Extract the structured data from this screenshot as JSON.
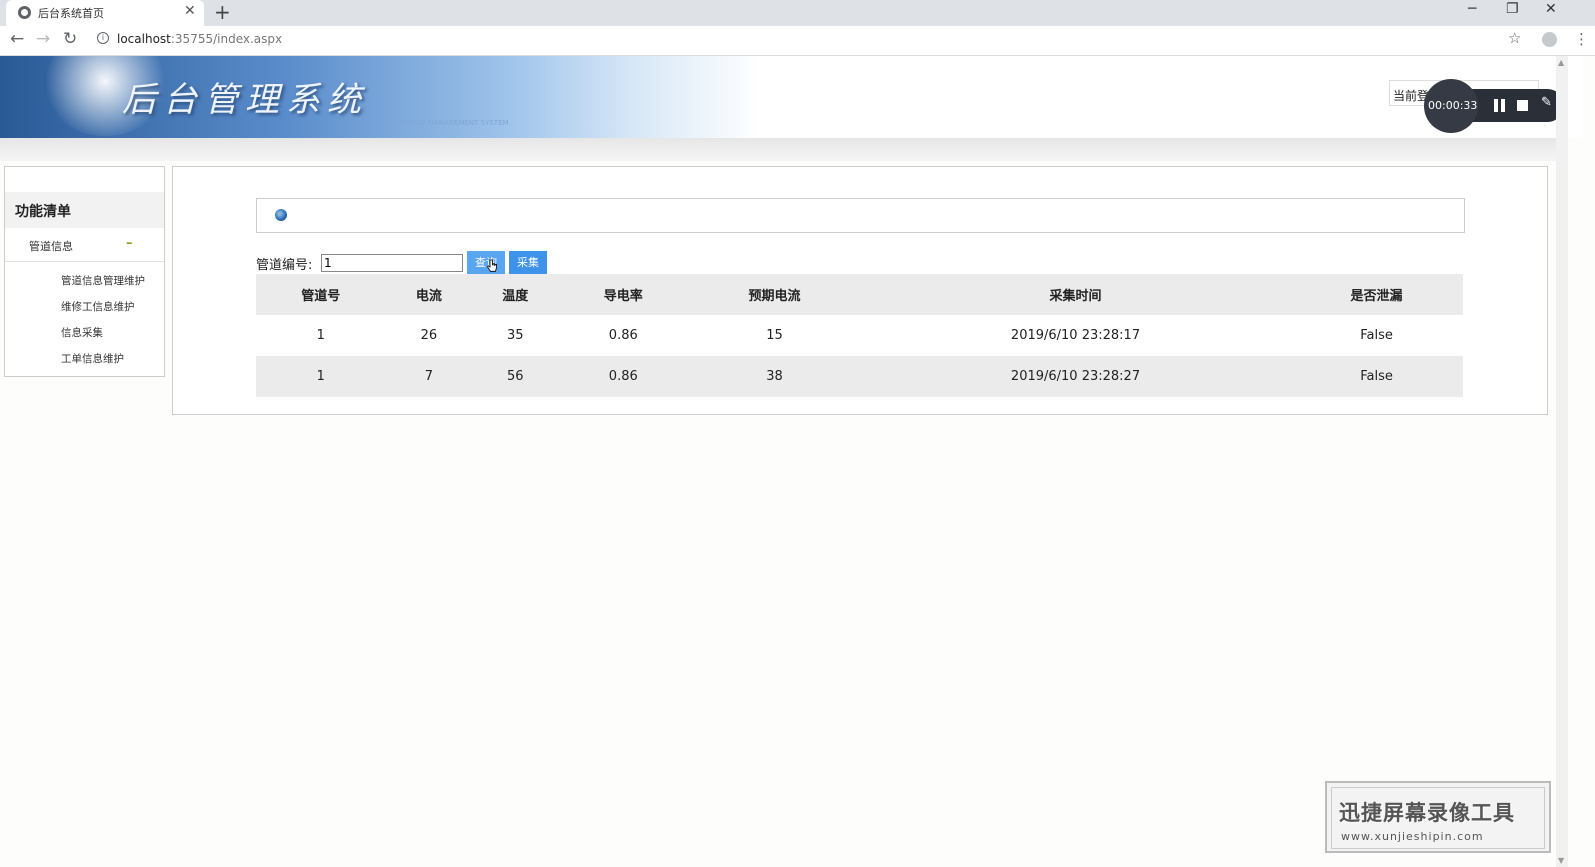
{
  "browser": {
    "tab_title": "后台系统首页",
    "tab_close": "✕",
    "new_tab": "+",
    "url_host": "localhost",
    "url_rest": ":35755/index.aspx",
    "controls": {
      "minimize": "─",
      "restore": "❐",
      "close": "✕"
    },
    "nav": {
      "back": "←",
      "forward": "→",
      "reload": "↻"
    },
    "star": "☆",
    "menu": "⋮"
  },
  "header": {
    "title": "后台管理系统",
    "subtitle": "BACKSTAGE MANAGEMENT SYSTEM",
    "login_label": "当前登"
  },
  "recorder": {
    "time": "00:00:33"
  },
  "sidebar": {
    "title": "功能清单",
    "group": {
      "label": "管道信息",
      "toggle": "–"
    },
    "items": [
      {
        "label": "管道信息管理维护"
      },
      {
        "label": "维修工信息维护"
      },
      {
        "label": "信息采集"
      },
      {
        "label": "工单信息维护"
      }
    ]
  },
  "query": {
    "label": "管道编号:",
    "value": "1",
    "query_button": "查询",
    "collect_button": "采集"
  },
  "table": {
    "headers": [
      "管道号",
      "电流",
      "温度",
      "导电率",
      "预期电流",
      "采集时间",
      "是否泄漏"
    ],
    "rows": [
      [
        "1",
        "26",
        "35",
        "0.86",
        "15",
        "2019/6/10 23:28:17",
        "False"
      ],
      [
        "1",
        "7",
        "56",
        "0.86",
        "38",
        "2019/6/10 23:28:27",
        "False"
      ]
    ]
  },
  "watermark": {
    "title": "迅捷屏幕录像工具",
    "url": "www.xunjieshipin.com"
  }
}
